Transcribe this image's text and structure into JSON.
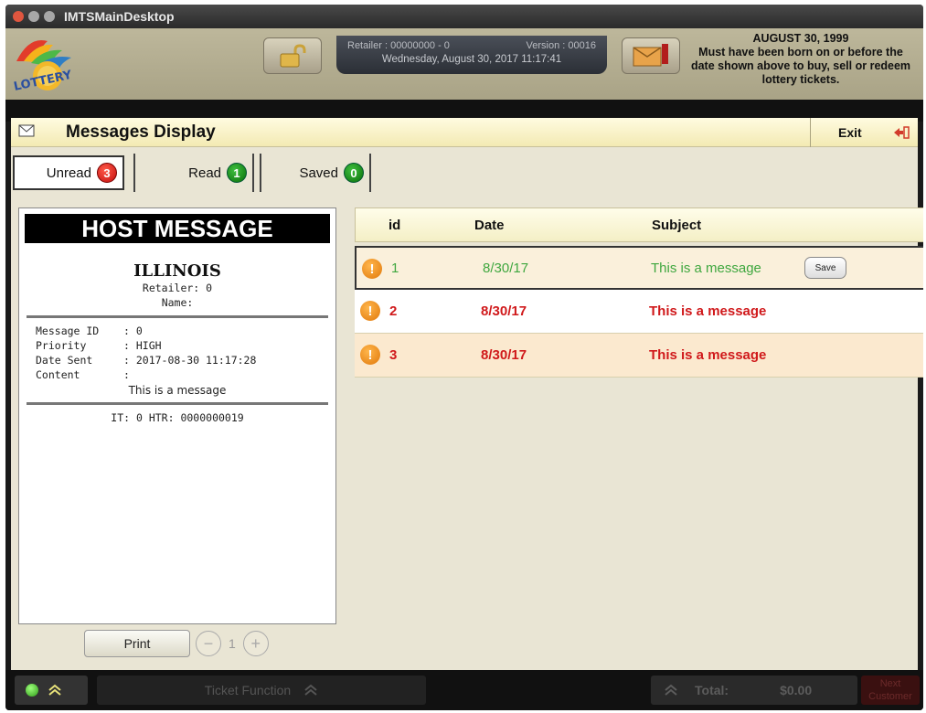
{
  "window": {
    "title": "IMTSMainDesktop"
  },
  "header": {
    "retailer_label": "Retailer : 00000000 - 0",
    "version_label": "Version : 00016",
    "datetime": "Wednesday, August 30, 2017 11:17:41",
    "age_date": "AUGUST 30, 1999",
    "age_notice": "Must have been born on or before the date shown above to buy, sell or redeem lottery tickets."
  },
  "messages": {
    "title": "Messages Display",
    "exit_label": "Exit",
    "tabs": [
      {
        "label": "Unread",
        "count": "3"
      },
      {
        "label": "Read",
        "count": "1"
      },
      {
        "label": "Saved",
        "count": "0"
      }
    ]
  },
  "receipt": {
    "heading": "HOST MESSAGE",
    "state": "ILLINOIS",
    "retailer": "Retailer: 0",
    "name": "Name:",
    "fields": [
      {
        "key": "Message ID",
        "value": ": 0"
      },
      {
        "key": "Priority",
        "value": ": HIGH"
      },
      {
        "key": "Date Sent",
        "value": ": 2017-08-30 11:17:28"
      },
      {
        "key": "Content",
        "value": ":"
      }
    ],
    "content": "This is a message",
    "footer": "IT: 0 HTR: 0000000019"
  },
  "pager": {
    "print_label": "Print",
    "page": "1",
    "minus": "−",
    "plus": "+"
  },
  "list": {
    "columns": {
      "id": "id",
      "date": "Date",
      "subject": "Subject"
    },
    "rows": [
      {
        "id": "1",
        "date": "8/30/17",
        "subject": "This is a message"
      },
      {
        "id": "2",
        "date": "8/30/17",
        "subject": "This is a message"
      },
      {
        "id": "3",
        "date": "8/30/17",
        "subject": "This is a message"
      }
    ],
    "save_label": "Save"
  },
  "bottombar": {
    "ticket_function": "Ticket Function",
    "total_label": "Total:",
    "total_value": "$0.00",
    "next_customer": "Next Customer"
  },
  "colors": {
    "unread_badge": "#c40e0e",
    "read_badge": "#0a6f0a",
    "read_row_text": "#3fa73f",
    "unread_row_text": "#d0191b",
    "header_bg": "#a9a386"
  }
}
